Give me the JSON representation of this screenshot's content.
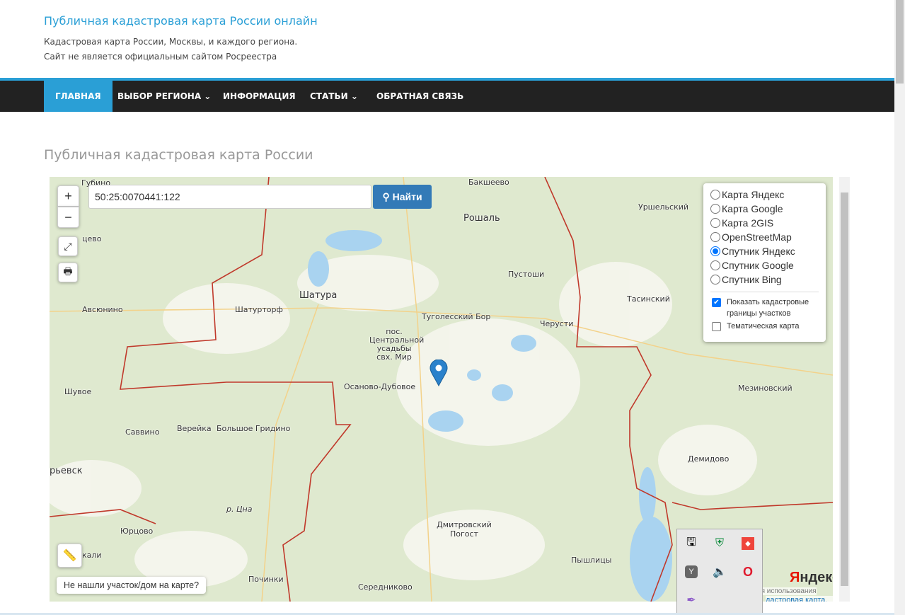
{
  "header": {
    "title": "Публичная кадастровая карта России онлайн",
    "subtitle1": "Кадастровая карта России, Москвы, и каждого региона.",
    "subtitle2": "Сайт не является официальным сайтом Росреестра"
  },
  "nav": [
    "ГЛАВНАЯ",
    "ВЫБОР РЕГИОНА ⌄",
    "ИНФОРМАЦИЯ",
    "СТАТЬИ ⌄",
    "ОБРАТНАЯ СВЯЗЬ"
  ],
  "page_title": "Публичная кадастровая карта России",
  "map": {
    "zoom_in": "+",
    "zoom_out": "−",
    "search_value": "50:25:0070441:122",
    "search_button": "Найти",
    "layers": [
      "Карта Яндекс",
      "Карта Google",
      "Карта 2GIS",
      "OpenStreetMap",
      "Спутник Яндекс",
      "Спутник Google",
      "Спутник Bing"
    ],
    "selected_layer": "Спутник Яндекс",
    "show_cadastral": "Показать кадастровые границы участков",
    "thematic": "Тематическая карта",
    "not_found": "Не нашли участок/дом на карте?",
    "yandex_logo": "Яндекс",
    "attribution": "дастровая карта, ©",
    "terms": "ия использования",
    "places": [
      "Рошаль",
      "Шатура",
      "Уршельский",
      "Пустоши",
      "Шатурторф",
      "Авсюнино",
      "Туголесский Бор",
      "Черусти",
      "Тасинский",
      "пос. Центральной усадьбы свх. Мир",
      "Осаново-Дубовое",
      "Шувое",
      "Мезиновский",
      "Саввино",
      "Верейка",
      "Большое Гридино",
      "Демидово",
      "рьевск",
      "р. Цна",
      "Юрцово",
      "Дмитровский Погост",
      "Пышлицы",
      "Починки",
      "Середниково",
      "кали",
      "Губино",
      "цево",
      "Бакшеево"
    ]
  }
}
